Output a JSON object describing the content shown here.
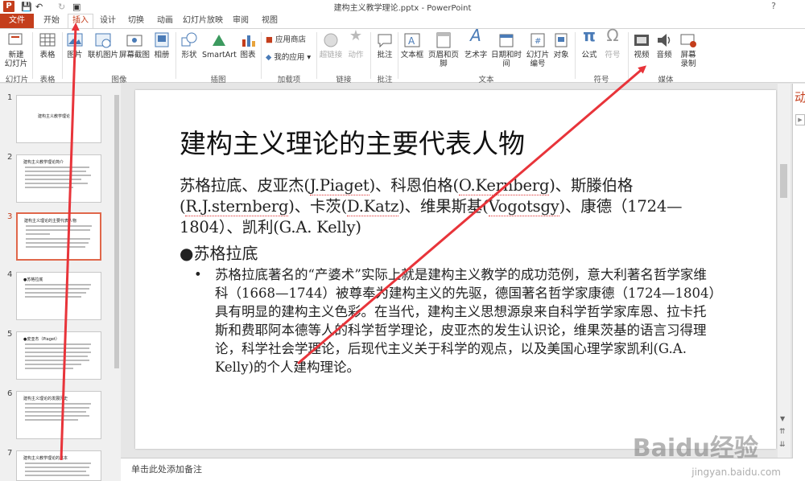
{
  "window": {
    "title": "建构主义教学理论.pptx - PowerPoint",
    "help": "?"
  },
  "tabs": [
    {
      "label": "文件"
    },
    {
      "label": "开始"
    },
    {
      "label": "插入"
    },
    {
      "label": "设计"
    },
    {
      "label": "切换"
    },
    {
      "label": "动画"
    },
    {
      "label": "幻灯片放映"
    },
    {
      "label": "审阅"
    },
    {
      "label": "视图"
    }
  ],
  "ribbon": {
    "new_slide": "新建\n幻灯片",
    "table": "表格",
    "picture": "图片",
    "online_picture": "联机图片",
    "screenshot": "屏幕截图",
    "album": "相册",
    "shapes": "形状",
    "smartart": "SmartArt",
    "chart": "图表",
    "app_store": "应用商店",
    "my_apps": "我的应用",
    "hyperlink": "超链接",
    "action": "动作",
    "comment": "批注",
    "textbox": "文本框",
    "header_footer": "页眉和页脚",
    "wordart": "艺术字",
    "datetime": "日期和时间",
    "slide_number": "幻灯片\n编号",
    "object": "对象",
    "equation": "公式",
    "symbol": "符号",
    "video": "视频",
    "audio": "音频",
    "screen_record": "屏幕\n录制",
    "groups": {
      "slides": "幻灯片",
      "tables": "表格",
      "images": "图像",
      "illustrations": "插图",
      "addins": "加载项",
      "links": "链接",
      "comments": "批注",
      "text": "文本",
      "symbols": "符号",
      "media": "媒体"
    }
  },
  "thumbnails": [
    {
      "num": "1",
      "title": "建构主义教学理论"
    },
    {
      "num": "2",
      "title": "建构主义教学理论简介"
    },
    {
      "num": "3",
      "title": "建构主义理论的主要代表人物"
    },
    {
      "num": "4",
      "title": "●苏格拉底"
    },
    {
      "num": "5",
      "title": "●皮亚杰（Piaget）"
    },
    {
      "num": "6",
      "title": "建构主义理论的发展历史"
    },
    {
      "num": "7",
      "title": "建构主义教学理论的基本"
    }
  ],
  "slide": {
    "title": "建构主义理论的主要代表人物",
    "intro_a": "苏格拉底、皮亚杰(",
    "piaget": "J.Piaget",
    "intro_b": ")、科恩伯格(",
    "kernberg": "O.Kernberg",
    "intro_c": ")、斯滕伯格(",
    "sternberg": "R.J.sternberg",
    "intro_d": ")、卡茨(",
    "katz": "D.Katz",
    "intro_e": ")、维果斯基(",
    "vogotsgy": "Vogotsgy",
    "intro_f": ")、康德（1724—1804）、凯利(G.A. Kelly)",
    "bullet": "●苏格拉底",
    "sub_dot": "•",
    "sub_text": "苏格拉底著名的“产婆术”实际上就是建构主义教学的成功范例，意大利著名哲学家维科（1668—1744）被尊奉为建构主义的先驱，德国著名哲学家康德（1724—1804）具有明显的建构主义色彩。在当代，建构主义思想源泉来自科学哲学家库恩、拉卡托斯和费耶阿本德等人的科学哲学理论，皮亚杰的发生认识论，维果茨基的语言习得理论，科学社会学理论，后现代主义关于科学的观点，以及美国心理学家凯利(G.A. Kelly)的个人建构理论。"
  },
  "notes_placeholder": "单击此处添加备注",
  "right_pane_label": "动",
  "watermark": {
    "brand": "Baidu经验",
    "url": "jingyan.baidu.com"
  },
  "colors": {
    "accent": "#c43e1c",
    "arrow": "#e8343a",
    "thumb_select": "#e0674a"
  }
}
